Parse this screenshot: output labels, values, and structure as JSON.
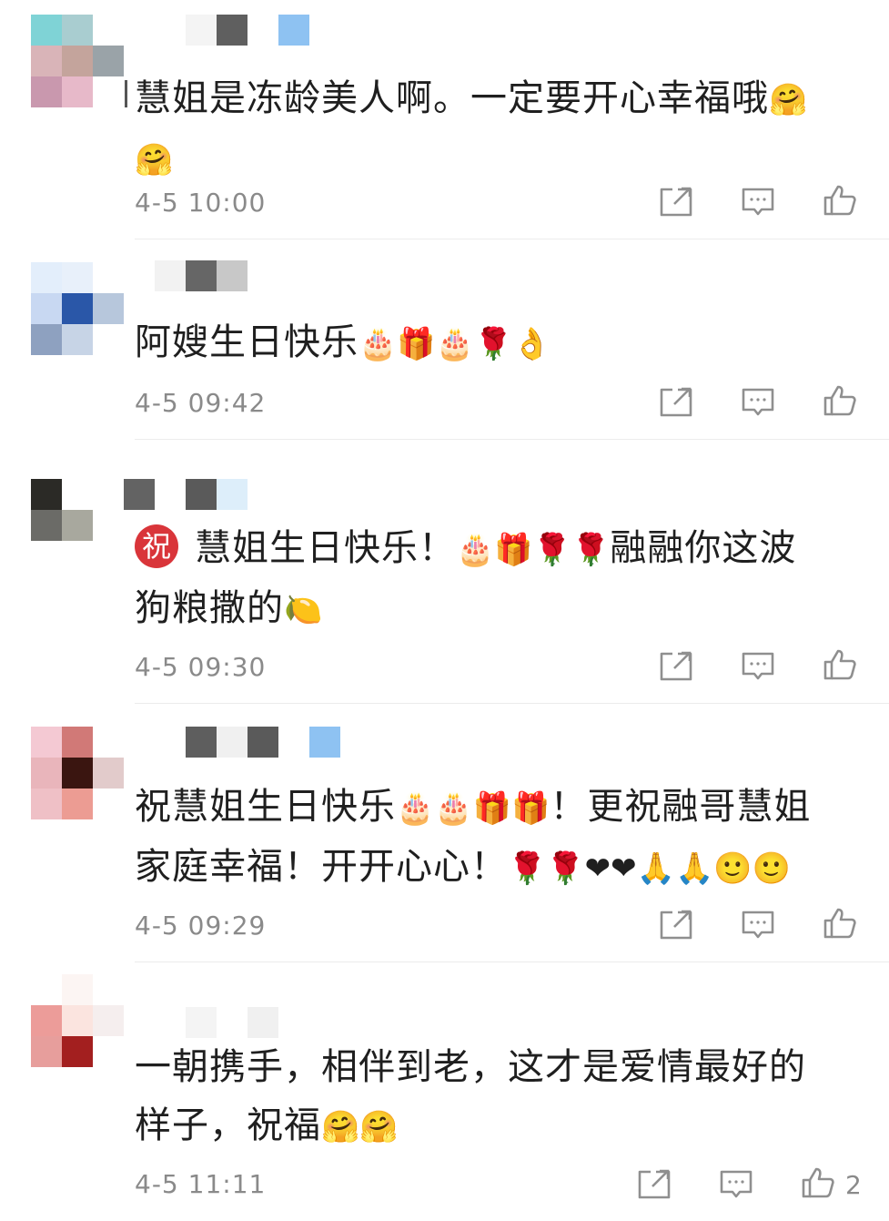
{
  "comments": [
    {
      "text": "慧姐是冻龄美人啊。一定要开心幸福哦",
      "emojis_inline": "🤗",
      "emojis_next_line": "🤗",
      "time": "4-5 10:00",
      "avatar_colors": [
        "#7fd3d6",
        "#a9cdd0",
        "#ffffff",
        "#d9b4b8",
        "#c4a49c",
        "#9aa3a8",
        "#c998ae",
        "#e7b9c9",
        "#ffffff"
      ],
      "name_colors": [
        "#f4f4f4",
        "#5f5f5f",
        "#ffffff",
        "#8ec2f2"
      ]
    },
    {
      "text": "阿嫂生日快乐",
      "emojis_inline": "🎂🎁🎂🌹👌",
      "time": "4-5 09:42",
      "avatar_colors": [
        "#e3eefb",
        "#e8f0fa",
        "#ffffff",
        "#c8d8f2",
        "#2a57a8",
        "#b7c7dc",
        "#8ea1c0",
        "#c7d4e6",
        "#ffffff"
      ],
      "name_colors": [
        "#f2f2f2",
        "#666666",
        "#c8c8c8"
      ]
    },
    {
      "badge": "祝",
      "text": "慧姐生日快乐！",
      "emojis_inline": "🎂🎁🌹🌹",
      "text_after": "融融你这波",
      "text_line2": "狗粮撒的",
      "emoji_line2": "🍋",
      "time": "4-5 09:30",
      "avatar_colors": [
        "#2b2a26",
        "#ffffff",
        "#ffffff",
        "#6b6b67",
        "#a8a89e",
        "#ffffff",
        "#ffffff",
        "#ffffff",
        "#ffffff"
      ],
      "name_colors": [
        "#636363",
        "#ffffff",
        "#5a5a5a",
        "#ddeefa"
      ]
    },
    {
      "text": "祝慧姐生日快乐",
      "emojis_inline": "🎂🎂🎁🎁",
      "text_after": "！更祝融哥慧姐",
      "text_line2": "家庭幸福！开开心心！",
      "emoji_line2": "🌹🌹❤❤🙏🙏🙂🙂",
      "time": "4-5 09:29",
      "avatar_colors": [
        "#f4c9d3",
        "#d17977",
        "#ffffff",
        "#e9b5bb",
        "#3a1510",
        "#e2cbcb",
        "#efc0c6",
        "#ec9c93",
        "#ffffff"
      ],
      "name_colors": [
        "#5e5e5e",
        "#f0f0f0",
        "#5a5a5a",
        "#ffffff",
        "#8ec2f2"
      ]
    },
    {
      "text": "一朝携手，相伴到老，这才是爱情最好的",
      "text_line2": "样子，祝福",
      "emoji_line2": "🤗🤗",
      "time": "4-5 11:11",
      "like_count": "2",
      "avatar_colors": [
        "#ffffff",
        "#fcf5f3",
        "#ffffff",
        "#ec9c99",
        "#fbe4df",
        "#f5eeee",
        "#e79e9c",
        "#a31f1f",
        "#ffffff"
      ],
      "name_colors": [
        "#f4f4f4",
        "#ffffff",
        "#f0f0f0"
      ]
    }
  ],
  "icons": {
    "share": "share-icon",
    "reply": "reply-icon",
    "like": "thumbs-up-icon"
  }
}
